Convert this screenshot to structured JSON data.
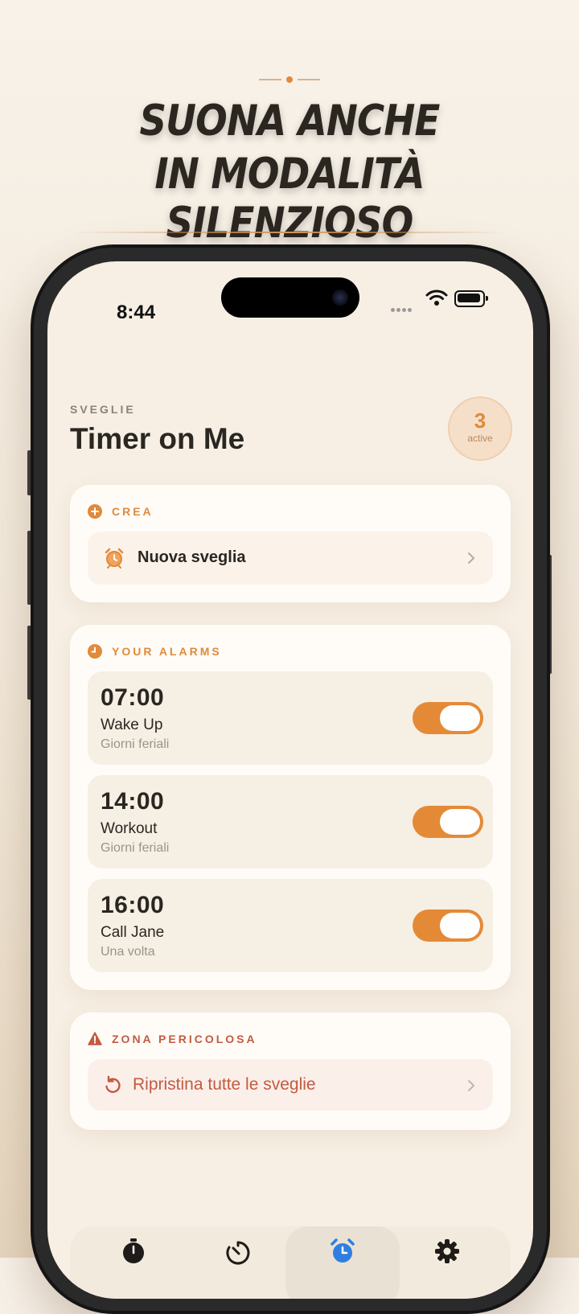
{
  "headline": {
    "line1": "SUONA ANCHE",
    "line2": "IN MODALITÀ SILENZIOSO"
  },
  "status_bar": {
    "time": "8:44"
  },
  "header": {
    "kicker": "SVEGLIE",
    "title": "Timer on Me",
    "active_count": "3",
    "active_label": "active"
  },
  "create_section": {
    "label": "CREA",
    "new_alarm_label": "Nuova sveglia"
  },
  "alarms_section": {
    "label": "YOUR ALARMS",
    "alarms": [
      {
        "time": "07:00",
        "name": "Wake Up",
        "repeat": "Giorni feriali",
        "enabled": true
      },
      {
        "time": "14:00",
        "name": "Workout",
        "repeat": "Giorni feriali",
        "enabled": true
      },
      {
        "time": "16:00",
        "name": "Call Jane",
        "repeat": "Una volta",
        "enabled": true
      }
    ]
  },
  "danger_section": {
    "label": "ZONA PERICOLOSA",
    "reset_label": "Ripristina tutte le sveglie"
  },
  "tabs": [
    {
      "icon": "stopwatch-icon",
      "active": false
    },
    {
      "icon": "timer-icon",
      "active": false
    },
    {
      "icon": "alarm-clock-icon",
      "active": true
    },
    {
      "icon": "gear-icon",
      "active": false
    }
  ],
  "colors": {
    "accent": "#e48a37",
    "danger": "#c45a3f",
    "background": "#f7efe4",
    "active_tab": "#2f7fe0"
  }
}
